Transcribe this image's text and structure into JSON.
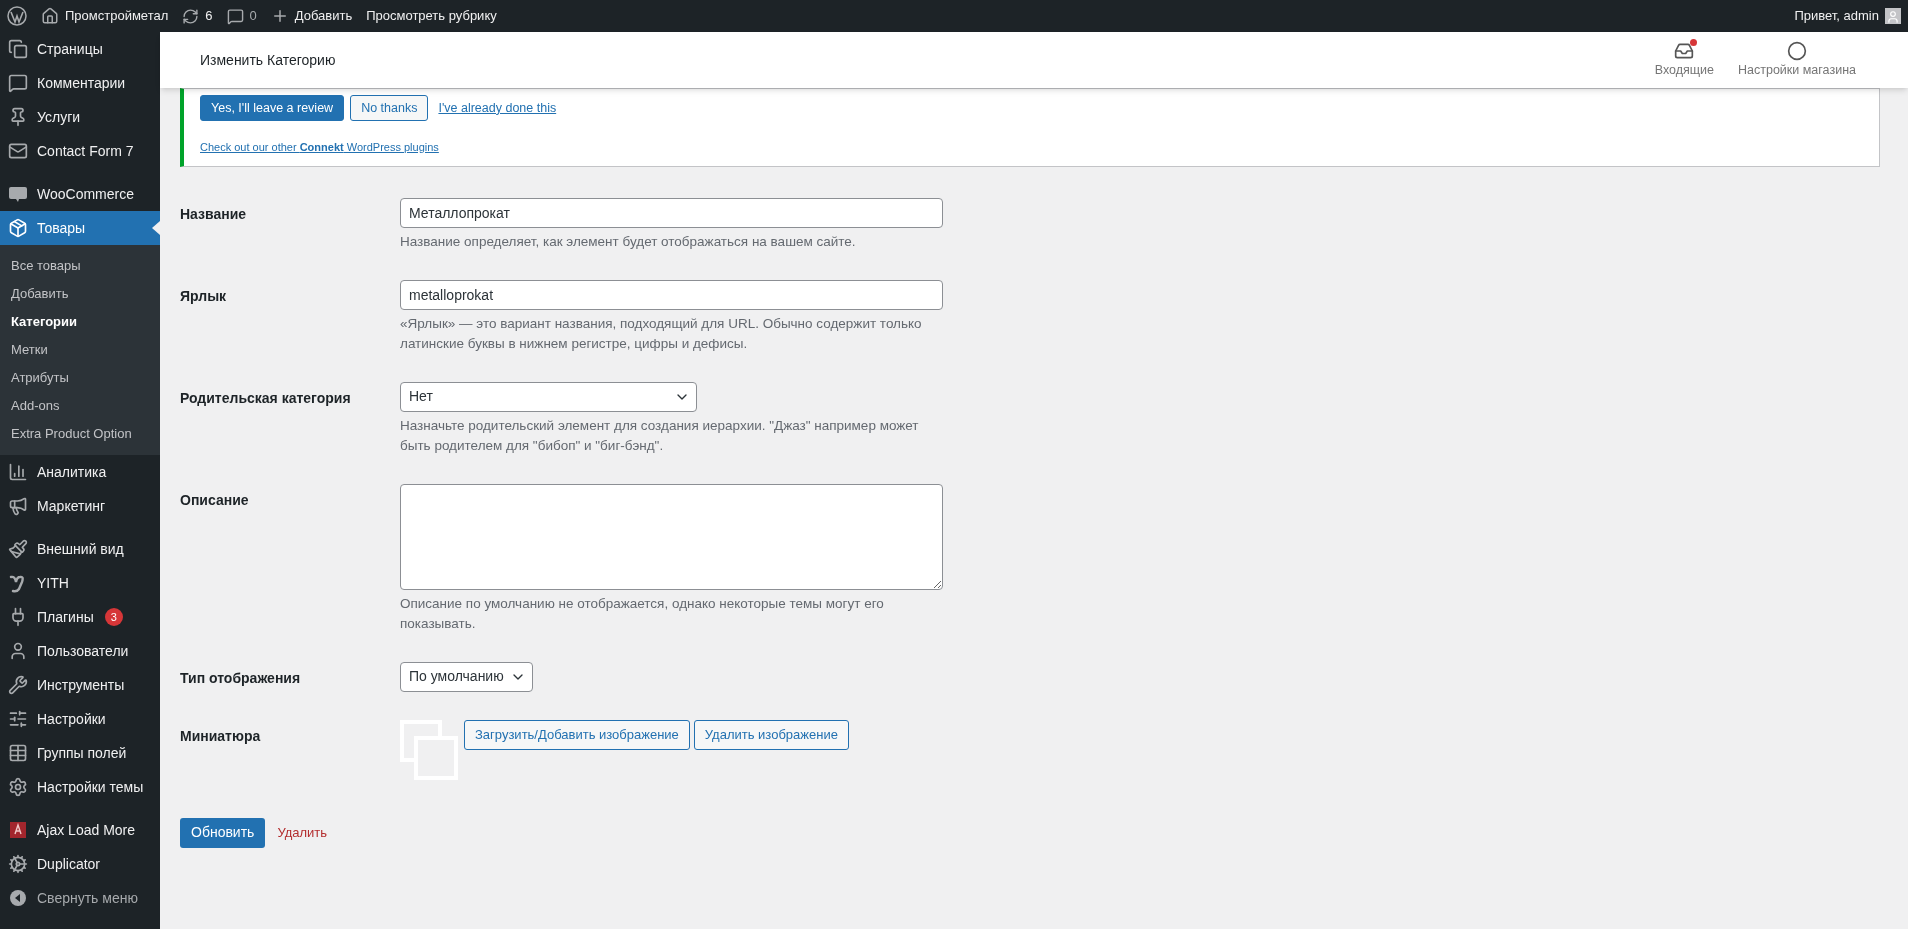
{
  "admin_bar": {
    "site_name": "Промстройметал",
    "updates_count": "6",
    "comments_count": "0",
    "new_label": "Добавить",
    "view_label": "Просмотреть рубрику",
    "greeting": "Привет, admin"
  },
  "sidebar": {
    "items": [
      {
        "kind": "menu",
        "label": "Страницы",
        "selected": false
      },
      {
        "kind": "menu",
        "label": "Комментарии",
        "selected": false
      },
      {
        "kind": "menu",
        "label": "Услуги",
        "selected": false
      },
      {
        "kind": "menu",
        "label": "Contact Form 7",
        "selected": false
      },
      {
        "kind": "separator"
      },
      {
        "kind": "menu",
        "label": "WooCommerce",
        "selected": false
      },
      {
        "kind": "menu",
        "label": "Товары",
        "selected": true,
        "children": [
          {
            "label": "Все товары",
            "selected": false
          },
          {
            "label": "Добавить",
            "selected": false
          },
          {
            "label": "Категории",
            "selected": true
          },
          {
            "label": "Метки",
            "selected": false
          },
          {
            "label": "Атрибуты",
            "selected": false
          },
          {
            "label": "Add-ons",
            "selected": false
          },
          {
            "label": "Extra Product Option",
            "selected": false
          }
        ]
      },
      {
        "kind": "menu",
        "label": "Аналитика",
        "selected": false
      },
      {
        "kind": "menu",
        "label": "Маркетинг",
        "selected": false
      },
      {
        "kind": "separator"
      },
      {
        "kind": "menu",
        "label": "Внешний вид",
        "selected": false
      },
      {
        "kind": "menu",
        "label": "YITH",
        "selected": false
      },
      {
        "kind": "menu",
        "label": "Плагины",
        "selected": false,
        "badge": "3"
      },
      {
        "kind": "menu",
        "label": "Пользователи",
        "selected": false
      },
      {
        "kind": "menu",
        "label": "Инструменты",
        "selected": false
      },
      {
        "kind": "menu",
        "label": "Настройки",
        "selected": false
      },
      {
        "kind": "menu",
        "label": "Группы полей",
        "selected": false
      },
      {
        "kind": "menu",
        "label": "Настройки темы",
        "selected": false
      },
      {
        "kind": "separator"
      },
      {
        "kind": "menu",
        "label": "Ajax Load More",
        "selected": false
      },
      {
        "kind": "menu",
        "label": "Duplicator",
        "selected": false
      },
      {
        "kind": "collapse",
        "label": "Свернуть меню",
        "selected": false
      }
    ]
  },
  "header": {
    "title": "Изменить Категорию",
    "actions": [
      {
        "label": "Входящие",
        "has_notification": true
      },
      {
        "label": "Настройки магазина",
        "has_notification": false
      }
    ]
  },
  "notice": {
    "buttons": [
      {
        "kind": "primary",
        "label": "Yes, I'll leave a review"
      },
      {
        "kind": "secondary",
        "label": "No thanks"
      },
      {
        "kind": "link",
        "label": "I've already done this"
      }
    ],
    "footer_link": "Check out our other **Connekt** WordPress plugins"
  },
  "form": {
    "fields": [
      {
        "kind": "text",
        "label": "Название",
        "value": "Металлопрокат",
        "description": "Название определяет, как элемент будет отображаться на вашем сайте."
      },
      {
        "kind": "text",
        "label": "Ярлык",
        "value": "metalloprokat",
        "description": "«Ярлык» — это вариант названия, подходящий для URL. Обычно содержит только латинские буквы в нижнем регистре, цифры и дефисы."
      },
      {
        "kind": "select",
        "label": "Родительская категория",
        "value": "Нет",
        "wide": true,
        "description": "Назначьте родительский элемент для создания иерархии. \"Джаз\" например может быть родителем для \"бибоп\" и \"биг-бэнд\"."
      },
      {
        "kind": "textarea",
        "label": "Описание",
        "description": "Описание по умолчанию не отображается, однако некоторые темы могут его показывать."
      },
      {
        "kind": "select",
        "label": "Тип отображения",
        "value": "По умолчанию",
        "wide": false
      },
      {
        "kind": "thumbnail",
        "label": "Миниатюра",
        "buttons": [
          "Загрузить/Добавить изображение",
          "Удалить изображение"
        ]
      }
    ]
  },
  "actions": {
    "update": "Обновить",
    "delete": "Удалить"
  }
}
